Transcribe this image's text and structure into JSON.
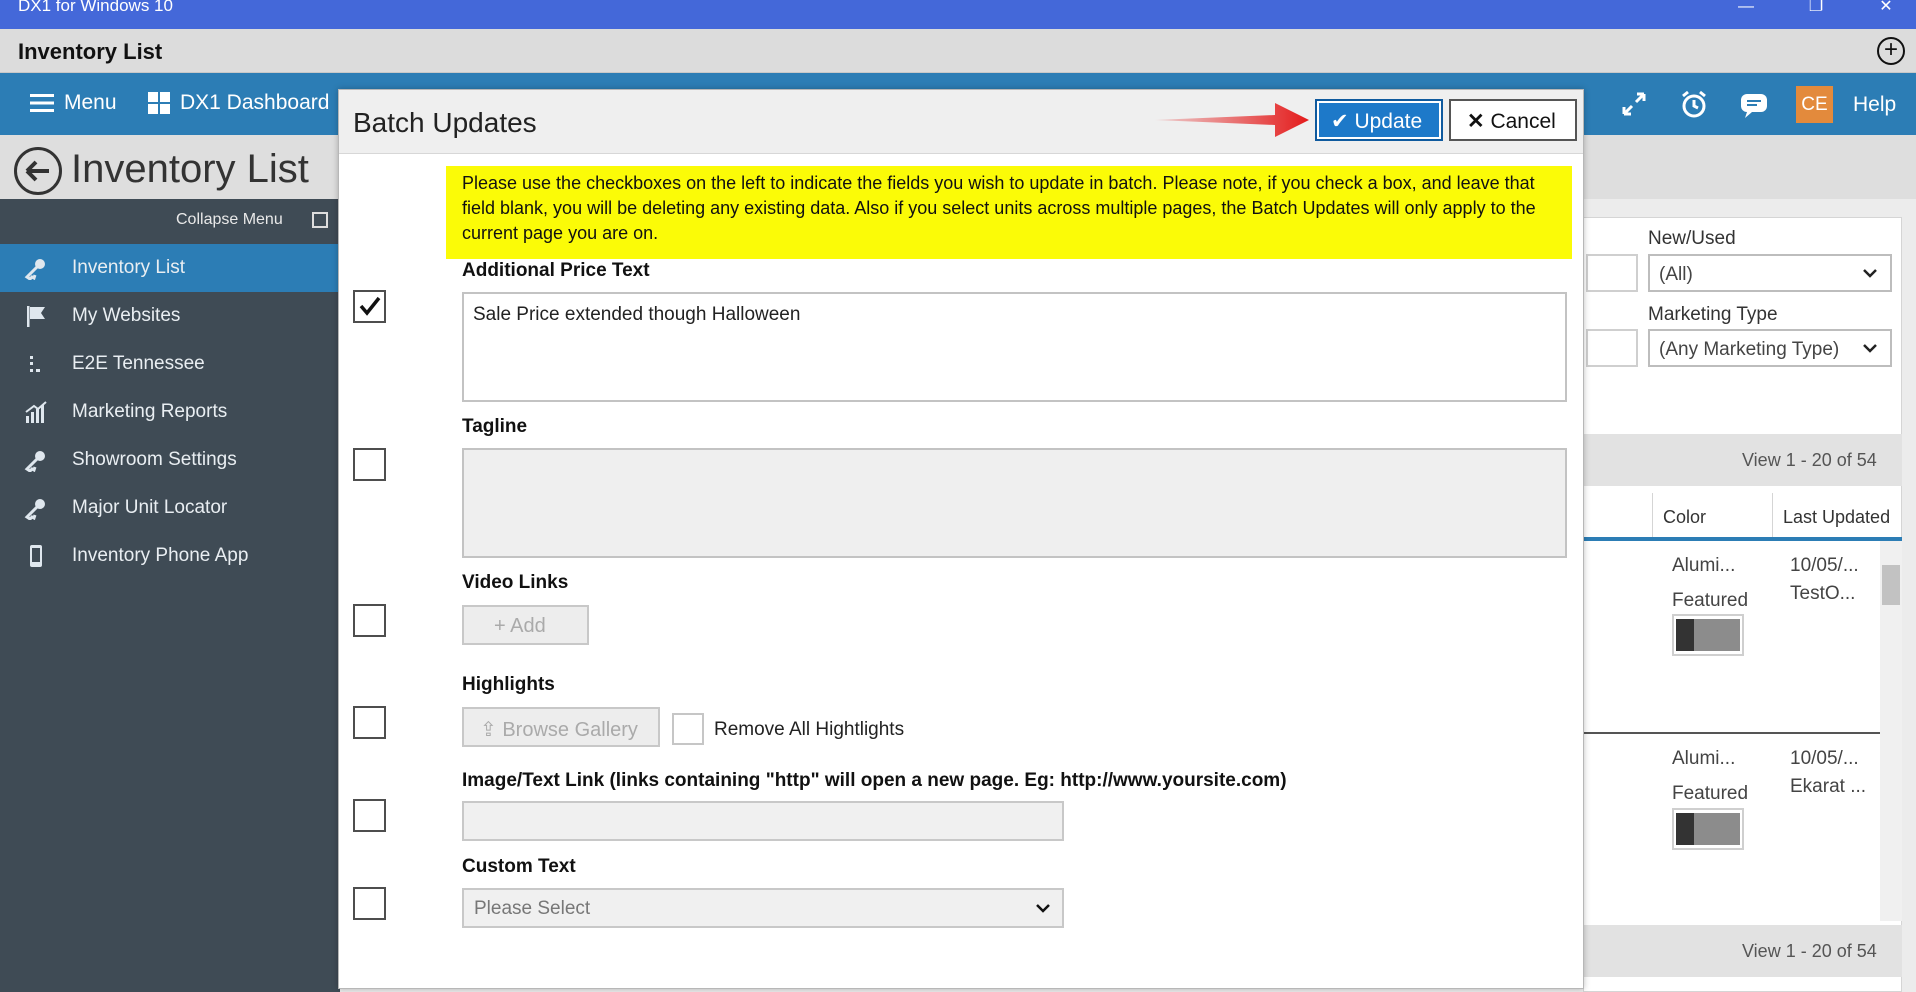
{
  "window": {
    "title": "DX1 for Windows 10",
    "minimize": "—",
    "maximize": "❐",
    "close": "✕"
  },
  "appbar": {
    "title": "Inventory List",
    "add_icon": "plus-circle-icon"
  },
  "navbar": {
    "menu_label": "Menu",
    "dashboard_label": "DX1 Dashboard",
    "avatar_initials": "CE",
    "help_label": "Help"
  },
  "page": {
    "title": "Inventory List"
  },
  "sidebar": {
    "collapse_label": "Collapse Menu",
    "items": [
      {
        "label": "Inventory List",
        "icon": "key-icon",
        "active": true
      },
      {
        "label": "My Websites",
        "icon": "flag-icon"
      },
      {
        "label": "E2E Tennessee",
        "icon": "dotted-list-icon"
      },
      {
        "label": "Marketing Reports",
        "icon": "chart-icon"
      },
      {
        "label": "Showroom Settings",
        "icon": "key-icon"
      },
      {
        "label": "Major Unit Locator",
        "icon": "key-icon"
      },
      {
        "label": "Inventory Phone App",
        "icon": "phone-icon"
      }
    ]
  },
  "filters": {
    "new_used_label": "New/Used",
    "new_used_value": "(All)",
    "marketing_type_label": "Marketing Type",
    "marketing_type_value": "(Any Marketing Type)"
  },
  "grid": {
    "view_top": "View 1 - 20 of 54",
    "view_bottom": "View 1 - 20 of 54",
    "columns": [
      "Color",
      "Last Updated"
    ],
    "rows": [
      {
        "color": "Alumi...",
        "updated": "10/05/...",
        "updated_by": "TestO...",
        "featured_label": "Featured"
      },
      {
        "color": "Alumi...",
        "updated": "10/05/...",
        "updated_by": "Ekarat ...",
        "featured_label": "Featured"
      }
    ]
  },
  "dialog": {
    "title": "Batch Updates",
    "update_label": "Update",
    "cancel_label": "Cancel",
    "notice": "Please use the checkboxes on the left to indicate the fields you wish to update in batch. Please note, if you check a box, and leave that field blank, you will be deleting any existing data. Also if you select units across multiple pages, the Batch Updates will only apply to the current page you are on.",
    "fields": {
      "additional_price_text": {
        "label": "Additional Price Text",
        "value": "Sale Price extended though Halloween",
        "checked": true
      },
      "tagline": {
        "label": "Tagline",
        "value": "",
        "checked": false
      },
      "video_links": {
        "label": "Video Links",
        "add_label": "Add",
        "checked": false
      },
      "highlights": {
        "label": "Highlights",
        "browse_label": "Browse Gallery",
        "remove_all_label": "Remove All Hightlights",
        "checked": false
      },
      "image_text_link": {
        "label": "Image/Text Link (links containing \"http\" will open a new page. Eg: http://www.yoursite.com)",
        "value": "",
        "checked": false
      },
      "custom_text": {
        "label": "Custom Text",
        "selected": "Please Select",
        "checked": false
      }
    }
  },
  "colors": {
    "titlebar": "#4468d9",
    "navbar": "#2c7db5",
    "sidebar": "#3f4b55",
    "notice": "#fbfb07",
    "update_button": "#1d79c9",
    "arrow": "#e41b1b"
  }
}
